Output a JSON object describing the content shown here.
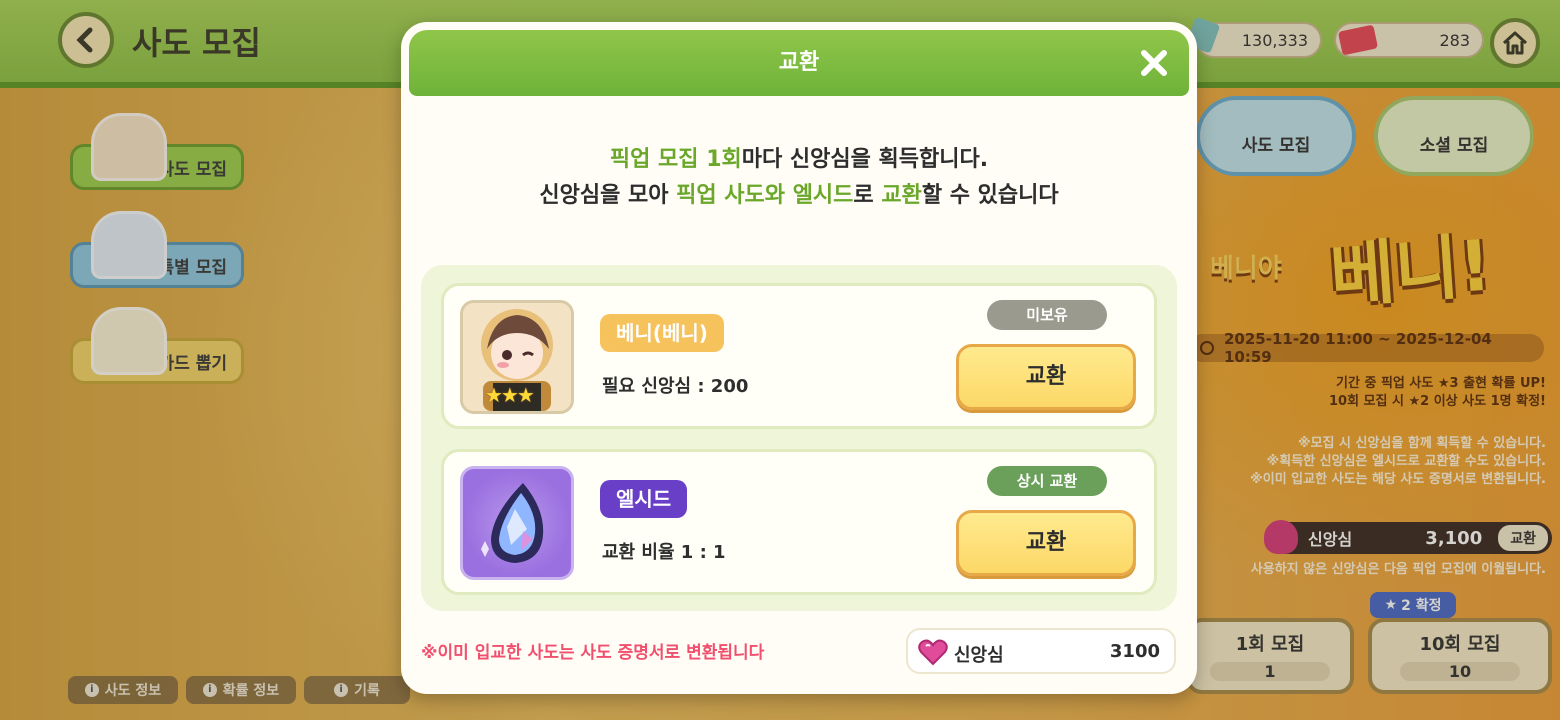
{
  "screen": {
    "title": "사도 모집",
    "resources": [
      {
        "icon": "crystal-icon",
        "value": "130,333"
      },
      {
        "icon": "ticket-icon",
        "value": "283"
      }
    ],
    "side_menu": [
      "사도 모집",
      "특별 모집",
      "카드 뽑기"
    ],
    "tabs": [
      "사도 모집",
      "소셜 모집"
    ],
    "banner": {
      "name": "베니!",
      "sub": "베니야",
      "period": "2025-11-20 11:00 ~ 2025-12-04 10:59",
      "notices": [
        "기간 중 픽업 사도 ★3 출현 확률 UP!",
        "10회 모집 시 ★2 이상 사도 1명 확정!",
        "※모집 시 신앙심을 함께 획득할 수 있습니다.",
        "※획득한 신앙심은 엘시드로 교환할 수도 있습니다.",
        "※이미 입교한 사도는 해당 사도 증명서로 변환됩니다."
      ],
      "currency_label": "신앙심",
      "currency_value": "3,100",
      "currency_button": "교환",
      "carry_note": "사용하지 않은 신앙심은 다음 픽업 모집에 이월됩니다."
    },
    "recruit": {
      "badge": "2 확정",
      "single": {
        "label": "1회 모집",
        "cost": "1"
      },
      "ten": {
        "label": "10회 모집",
        "cost": "10"
      }
    },
    "bottom": [
      "사도 정보",
      "확률 정보",
      "기록"
    ]
  },
  "modal": {
    "title": "교환",
    "desc_line1": {
      "pre": "픽업 모집 1회",
      "post": "마다 신앙심을 획득합니다."
    },
    "desc_line2": {
      "a": "신앙심을 모아 ",
      "b": "픽업 사도와 엘시드",
      "c": "로 ",
      "d": "교환",
      "e": "할 수 있습니다"
    },
    "items": [
      {
        "name": "베니(베니)",
        "requirement": "필요 신앙심 : 200",
        "status": "미보유",
        "button": "교환",
        "stars": 3,
        "colors": {
          "badge": "#f5c25b",
          "status": "#9a9a8e"
        }
      },
      {
        "name": "엘시드",
        "requirement": "교환 비율 1 : 1",
        "status": "상시 교환",
        "button": "교환",
        "colors": {
          "badge": "#6a3fc8",
          "status": "#6aa05a"
        }
      }
    ],
    "warning": "※이미 입교한 사도는 사도 증명서로 변환됩니다",
    "owned": {
      "label": "신앙심",
      "value": "3100"
    }
  }
}
